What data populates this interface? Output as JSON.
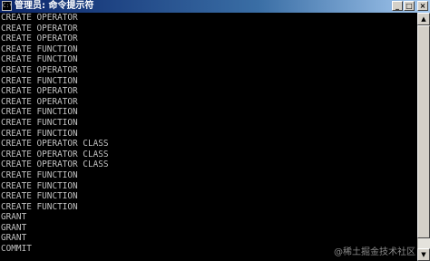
{
  "window": {
    "title": "管理员: 命令提示符",
    "icon": "cmd-icon",
    "buttons": {
      "minimize": "_",
      "maximize": "□",
      "close": "×"
    }
  },
  "console": {
    "lines": [
      "CREATE OPERATOR",
      "CREATE OPERATOR",
      "CREATE OPERATOR",
      "CREATE FUNCTION",
      "CREATE FUNCTION",
      "CREATE OPERATOR",
      "CREATE FUNCTION",
      "CREATE OPERATOR",
      "CREATE OPERATOR",
      "CREATE FUNCTION",
      "CREATE FUNCTION",
      "CREATE FUNCTION",
      "CREATE OPERATOR CLASS",
      "CREATE OPERATOR CLASS",
      "CREATE OPERATOR CLASS",
      "CREATE FUNCTION",
      "CREATE FUNCTION",
      "CREATE FUNCTION",
      "CREATE FUNCTION",
      "GRANT",
      "GRANT",
      "GRANT",
      "COMMIT"
    ]
  },
  "scrollbar": {
    "up_arrow": "▲",
    "down_arrow": "▼"
  },
  "watermark": "@稀土掘金技术社区",
  "colors": {
    "background": "#000000",
    "text": "#c0c0c0",
    "titlebar_start": "#0a246a",
    "titlebar_end": "#a6caf0"
  }
}
